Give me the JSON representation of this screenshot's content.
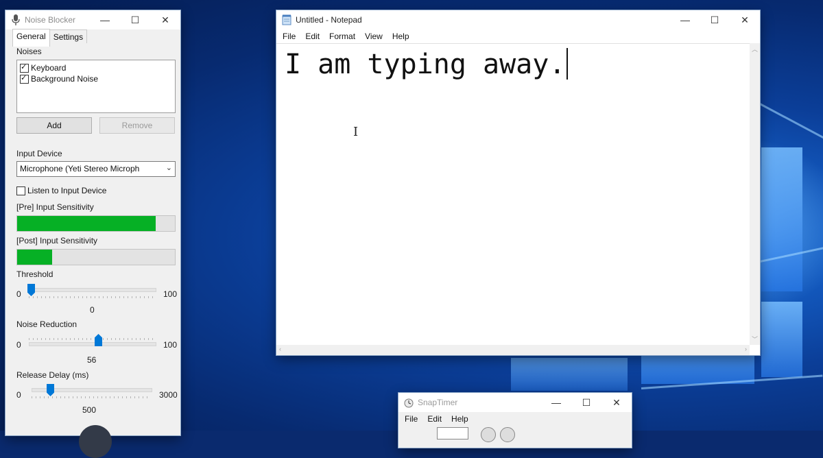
{
  "noise_blocker": {
    "title": "Noise Blocker",
    "window_buttons": {
      "minimize": "—",
      "maximize": "☐",
      "close": "✕"
    },
    "tabs": [
      {
        "label": "General"
      },
      {
        "label": "Settings"
      }
    ],
    "noises_label": "Noises",
    "noises": [
      {
        "label": "Keyboard",
        "checked": true
      },
      {
        "label": "Background Noise",
        "checked": true
      }
    ],
    "add_label": "Add",
    "remove_label": "Remove",
    "input_device_label": "Input Device",
    "input_device_value": "Microphone (Yeti Stereo Microph",
    "listen_label": "Listen to Input Device",
    "listen_checked": false,
    "pre_sensitivity_label": "[Pre] Input Sensitivity",
    "pre_sensitivity_level": 0.88,
    "post_sensitivity_label": "[Post] Input Sensitivity",
    "post_sensitivity_level": 0.22,
    "threshold": {
      "label": "Threshold",
      "min": "0",
      "max": "100",
      "value": "0"
    },
    "noise_reduction": {
      "label": "Noise Reduction",
      "min": "0",
      "max": "100",
      "value": "56"
    },
    "release_delay": {
      "label": "Release Delay (ms)",
      "min": "0",
      "max": "3000",
      "value": "500"
    },
    "accent_color": "#0078d7",
    "meter_color": "#06b025"
  },
  "notepad": {
    "title": "Untitled - Notepad",
    "window_buttons": {
      "minimize": "—",
      "maximize": "☐",
      "close": "✕"
    },
    "menu": [
      {
        "label": "File"
      },
      {
        "label": "Edit"
      },
      {
        "label": "Format"
      },
      {
        "label": "View"
      },
      {
        "label": "Help"
      }
    ],
    "content": "I am typing away.",
    "cursor_glyph": "I"
  },
  "snaptimer": {
    "title": "SnapTimer",
    "window_buttons": {
      "minimize": "—",
      "maximize": "☐",
      "close": "✕"
    },
    "menu": [
      {
        "label": "File"
      },
      {
        "label": "Edit"
      },
      {
        "label": "Help"
      }
    ]
  }
}
